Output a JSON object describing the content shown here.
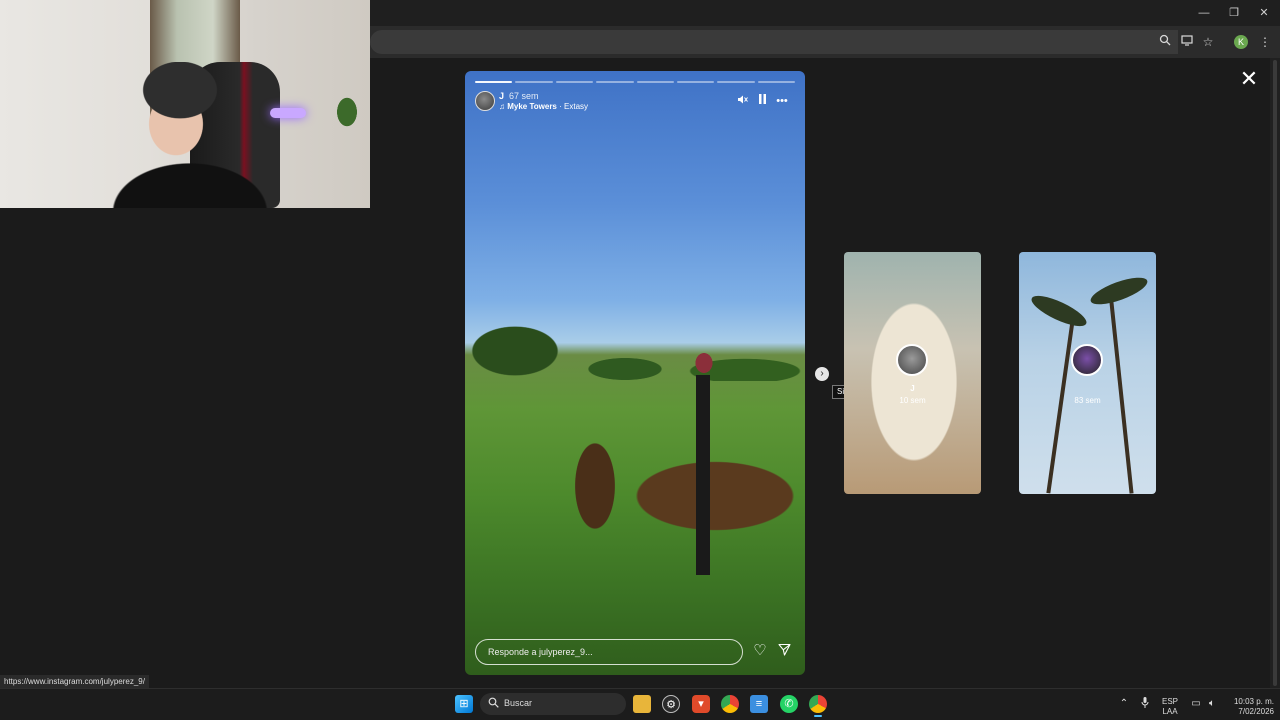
{
  "browser": {
    "window_controls": {
      "minimize": "—",
      "restore": "❐",
      "close": "✕"
    },
    "toolbar_icons": [
      "zoom-icon",
      "install-icon",
      "star-icon",
      "menu-icon"
    ],
    "profile_initial": "K"
  },
  "story": {
    "username": "J",
    "time": "67 sem",
    "music_artist": "Myke Towers",
    "music_song": "· Extasy",
    "reply_placeholder": "Responde a julyperez_9...",
    "segments_total": 8,
    "segments_done": 1
  },
  "next": {
    "tooltip": "Siguiente"
  },
  "upcoming": [
    {
      "name": "J",
      "time": "10 sem"
    },
    {
      "name": "",
      "time": "83 sem"
    }
  ],
  "status_url": "https://www.instagram.com/julyperez_9/",
  "taskbar": {
    "search_label": "Buscar",
    "language_line1": "ESP",
    "language_line2": "LAA",
    "time": "10:03 p. m.",
    "date": "7/02/2026"
  }
}
